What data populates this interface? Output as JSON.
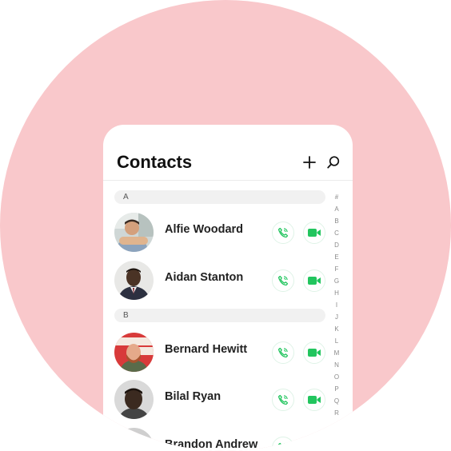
{
  "header": {
    "title": "Contacts"
  },
  "sections": [
    {
      "letter": "A",
      "contacts": [
        {
          "name": "Alfie Woodard"
        },
        {
          "name": "Aidan Stanton"
        }
      ]
    },
    {
      "letter": "B",
      "contacts": [
        {
          "name": "Bernard Hewitt"
        },
        {
          "name": "Bilal Ryan"
        },
        {
          "name": "Brandon Andrew"
        }
      ]
    }
  ],
  "alphabet": [
    "#",
    "A",
    "B",
    "C",
    "D",
    "E",
    "F",
    "G",
    "H",
    "I",
    "J",
    "K",
    "L",
    "M",
    "N",
    "O",
    "P",
    "Q",
    "R"
  ],
  "icons": {
    "add": "plus-icon",
    "search": "search-icon",
    "call": "phone-icon",
    "video": "video-camera-icon"
  },
  "colors": {
    "background_circle": "#f9c8cb",
    "accent_green": "#22c55e",
    "card": "#ffffff"
  }
}
